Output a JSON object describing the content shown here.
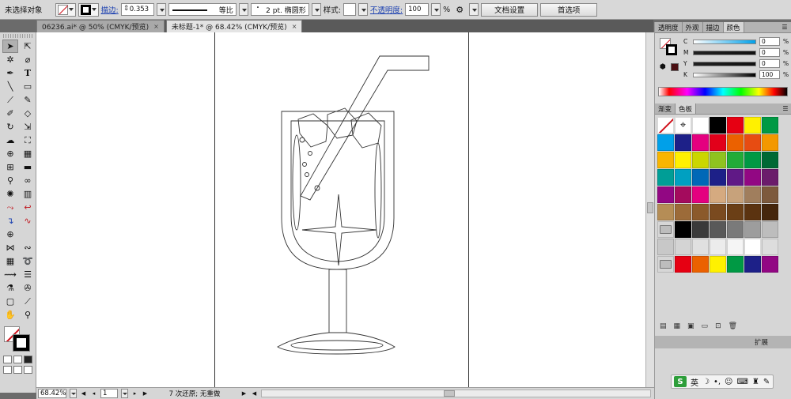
{
  "control_bar": {
    "selection": "未选择对象",
    "stroke_label": "描边:",
    "stroke_weight": "0.353",
    "profile": "等比",
    "brush": "2 pt. 椭圆形",
    "style_label": "样式:",
    "opacity_label": "不透明度:",
    "opacity_value": "100",
    "opacity_unit": "%",
    "doc_setup": "文档设置",
    "preferences": "首选项"
  },
  "tabs": [
    {
      "label": "06236.ai* @ 50% (CMYK/预览)",
      "close": "×"
    },
    {
      "label": "未标题-1* @ 68.42% (CMYK/预览)",
      "close": "×"
    }
  ],
  "panels": {
    "top_tabs": [
      "透明度",
      "外观",
      "描边",
      "颜色"
    ],
    "cmyk": [
      {
        "label": "C",
        "value": "0"
      },
      {
        "label": "M",
        "value": "0"
      },
      {
        "label": "Y",
        "value": "0"
      },
      {
        "label": "K",
        "value": "100"
      }
    ],
    "percent": "%",
    "swatch_tabs": [
      "渐变",
      "色板"
    ],
    "expand_label": "扩展",
    "swatches": [
      [
        "none",
        "reg",
        "#ffffff",
        "#000000",
        "#e60012",
        "#fff100",
        "#009944"
      ],
      [
        "#00a0e9",
        "#1d2088",
        "#e4007f",
        "#e2001a",
        "#eb6100",
        "#e74c12",
        "#f39800"
      ],
      [
        "#f8b500",
        "#fff000",
        "#cbd600",
        "#8fc31f",
        "#22ac38",
        "#009944",
        "#006934"
      ],
      [
        "#009e96",
        "#00a0c1",
        "#0068b7",
        "#1d2088",
        "#601986",
        "#920783",
        "#6b1c6b"
      ],
      [
        "#920783",
        "#a40b5d",
        "#e4007f",
        "#d5aa80",
        "#c7a27b",
        "#a07e5d",
        "#7d5a3d"
      ],
      [
        "#b58d56",
        "#9c6b39",
        "#8b5a2b",
        "#7a4a1f",
        "#6b3f16",
        "#5b3310",
        "#45260c"
      ],
      [
        "folder",
        "#000000",
        "#3a3a3a",
        "#595959",
        "#7a7a7a",
        "#9d9d9d",
        "#bdbdbd"
      ],
      [
        "#c8c8c8",
        "#d4d4d4",
        "#e0e0e0",
        "#ececec",
        "#f5f5f5",
        "#ffffff",
        "#dddddd"
      ],
      [
        "folder",
        "#e60012",
        "#eb6100",
        "#fff100",
        "#009944",
        "#1d2088",
        "#920783"
      ]
    ]
  },
  "status_bar": {
    "zoom": "68.42%",
    "page": "1",
    "status": "7 次还原; 无重做"
  },
  "ime": {
    "logo": "S",
    "lang": "英"
  },
  "colors": {
    "accent_red": "#d0101a",
    "link_blue": "#1a3fb0"
  }
}
